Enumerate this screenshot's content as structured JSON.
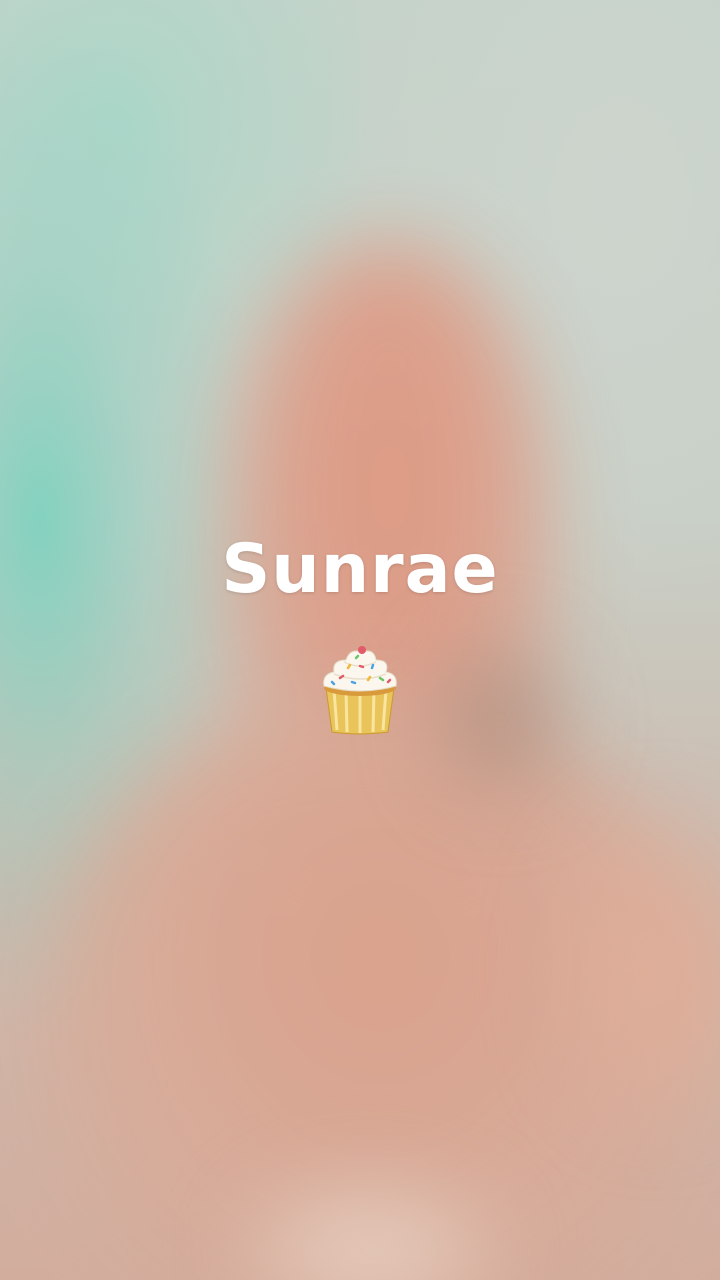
{
  "caption": {
    "title": "Sunrae",
    "emoji_icon": "cupcake-icon"
  }
}
